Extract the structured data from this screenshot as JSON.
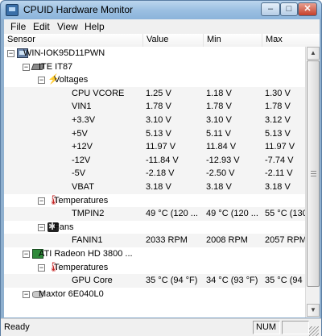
{
  "window": {
    "title": "CPUID Hardware Monitor"
  },
  "titlebar_buttons": {
    "minimize": "–",
    "maximize": "□",
    "close": "✕"
  },
  "menu": [
    "File",
    "Edit",
    "View",
    "Help"
  ],
  "columns": [
    "Sensor",
    "Value",
    "Min",
    "Max"
  ],
  "rows": [
    {
      "label": "WIN-IOK95D11PWN",
      "value": "",
      "min": "",
      "max": "",
      "icon": "computer-icon",
      "expander": "−"
    },
    {
      "label": "ITE IT87",
      "value": "",
      "min": "",
      "max": "",
      "icon": "chip-icon",
      "expander": "−"
    },
    {
      "label": "Voltages",
      "value": "",
      "min": "",
      "max": "",
      "icon": "voltage-icon",
      "expander": "−"
    },
    {
      "label": "CPU VCORE",
      "value": "1.25 V",
      "min": "1.18 V",
      "max": "1.30 V",
      "icon": "",
      "expander": ""
    },
    {
      "label": "VIN1",
      "value": "1.78 V",
      "min": "1.78 V",
      "max": "1.78 V",
      "icon": "",
      "expander": ""
    },
    {
      "label": "+3.3V",
      "value": "3.10 V",
      "min": "3.10 V",
      "max": "3.12 V",
      "icon": "",
      "expander": ""
    },
    {
      "label": "+5V",
      "value": "5.13 V",
      "min": "5.11 V",
      "max": "5.13 V",
      "icon": "",
      "expander": ""
    },
    {
      "label": "+12V",
      "value": "11.97 V",
      "min": "11.84 V",
      "max": "11.97 V",
      "icon": "",
      "expander": ""
    },
    {
      "label": "-12V",
      "value": "-11.84 V",
      "min": "-12.93 V",
      "max": "-7.74 V",
      "icon": "",
      "expander": ""
    },
    {
      "label": "-5V",
      "value": "-2.18 V",
      "min": "-2.50 V",
      "max": "-2.11 V",
      "icon": "",
      "expander": ""
    },
    {
      "label": "VBAT",
      "value": "3.18 V",
      "min": "3.18 V",
      "max": "3.18 V",
      "icon": "",
      "expander": ""
    },
    {
      "label": "Temperatures",
      "value": "",
      "min": "",
      "max": "",
      "icon": "thermometer-icon",
      "expander": "−"
    },
    {
      "label": "TMPIN2",
      "value": "49 °C  (120 ...",
      "min": "49 °C  (120 ...",
      "max": "55 °C  (130",
      "icon": "",
      "expander": ""
    },
    {
      "label": "Fans",
      "value": "",
      "min": "",
      "max": "",
      "icon": "fan-icon",
      "expander": "−"
    },
    {
      "label": "FANIN1",
      "value": "2033 RPM",
      "min": "2008 RPM",
      "max": "2057 RPM",
      "icon": "",
      "expander": ""
    },
    {
      "label": "ATI Radeon HD 3800 ...",
      "value": "",
      "min": "",
      "max": "",
      "icon": "gpu-icon",
      "expander": "−"
    },
    {
      "label": "Temperatures",
      "value": "",
      "min": "",
      "max": "",
      "icon": "thermometer-icon",
      "expander": "−"
    },
    {
      "label": "GPU Core",
      "value": "35 °C  (94 °F)",
      "min": "34 °C  (93 °F)",
      "max": "35 °C  (94 °",
      "icon": "",
      "expander": ""
    },
    {
      "label": "Maxtor 6E040L0",
      "value": "",
      "min": "",
      "max": "",
      "icon": "hard-drive-icon",
      "expander": "−"
    }
  ],
  "status": {
    "text": "Ready",
    "num": "NUM"
  }
}
